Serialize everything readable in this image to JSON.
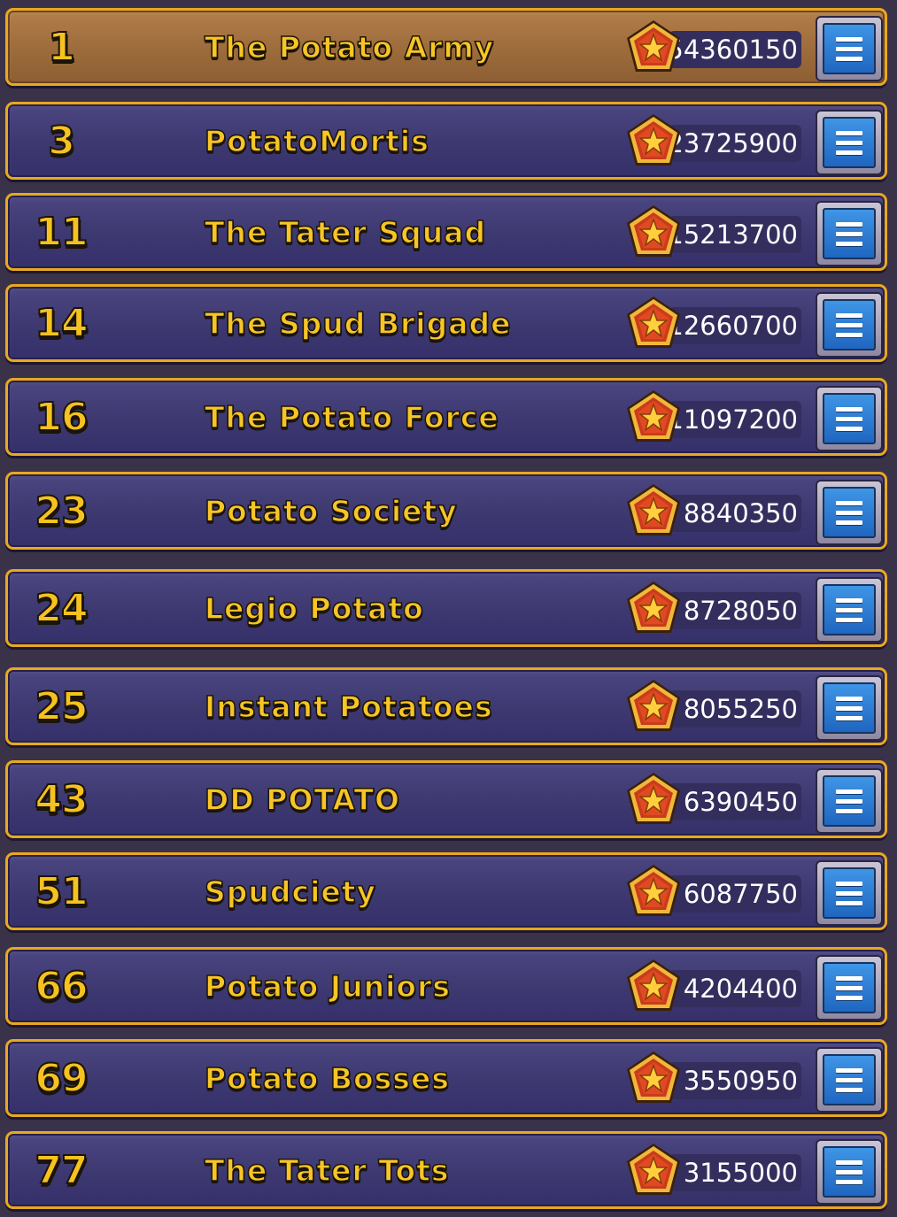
{
  "leaderboard": {
    "rows": [
      {
        "rank": "1",
        "name": "The Potato Army",
        "score": "54360150",
        "highlight": true
      },
      {
        "rank": "3",
        "name": "PotatoMortis",
        "score": "23725900",
        "highlight": false
      },
      {
        "rank": "11",
        "name": "The Tater Squad",
        "score": "15213700",
        "highlight": false
      },
      {
        "rank": "14",
        "name": "The Spud Brigade",
        "score": "12660700",
        "highlight": false
      },
      {
        "rank": "16",
        "name": "The Potato Force",
        "score": "11097200",
        "highlight": false
      },
      {
        "rank": "23",
        "name": "Potato Society",
        "score": "8840350",
        "highlight": false
      },
      {
        "rank": "24",
        "name": "Legio Potato",
        "score": "8728050",
        "highlight": false
      },
      {
        "rank": "25",
        "name": "Instant Potatoes",
        "score": "8055250",
        "highlight": false
      },
      {
        "rank": "43",
        "name": "DD POTATO",
        "score": "6390450",
        "highlight": false
      },
      {
        "rank": "51",
        "name": "Spudciety",
        "score": "6087750",
        "highlight": false
      },
      {
        "rank": "66",
        "name": "Potato Juniors",
        "score": "4204400",
        "highlight": false
      },
      {
        "rank": "69",
        "name": "Potato Bosses",
        "score": "3550950",
        "highlight": false
      },
      {
        "rank": "77",
        "name": "The Tater Tots",
        "score": "3155000",
        "highlight": false
      }
    ],
    "badge_icon": "star-medal-icon",
    "menu_icon": "menu-icon",
    "colors": {
      "row_border": "#e8a820",
      "row_background": "#3d3870",
      "top_row_background": "#9b6a3a",
      "name_text": "#f7c526",
      "menu_button": "#2a78d4"
    }
  }
}
